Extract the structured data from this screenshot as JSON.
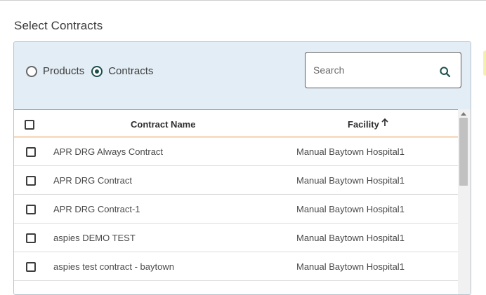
{
  "section": {
    "title": "Select Contracts"
  },
  "filter": {
    "options": [
      {
        "label": "Products",
        "selected": false
      },
      {
        "label": "Contracts",
        "selected": true
      }
    ],
    "search": {
      "placeholder": "Search",
      "value": ""
    }
  },
  "table": {
    "columns": {
      "contract_name": "Contract Name",
      "facility": "Facility"
    },
    "sort": {
      "column": "Facility",
      "direction": "ascending"
    },
    "rows": [
      {
        "contract_name": "APR DRG Always Contract",
        "facility": "Manual Baytown Hospital1",
        "checked": false
      },
      {
        "contract_name": "APR DRG Contract",
        "facility": "Manual Baytown Hospital1",
        "checked": false
      },
      {
        "contract_name": "APR DRG Contract-1",
        "facility": "Manual Baytown Hospital1",
        "checked": false
      },
      {
        "contract_name": "aspies DEMO TEST",
        "facility": "Manual Baytown Hospital1",
        "checked": false
      },
      {
        "contract_name": "aspies test contract - baytown",
        "facility": "Manual Baytown Hospital1",
        "checked": false
      }
    ]
  },
  "colors": {
    "accent_border": "#e68a3a",
    "selected_radio": "#1b4e4b",
    "filter_background": "#e3edf5"
  }
}
